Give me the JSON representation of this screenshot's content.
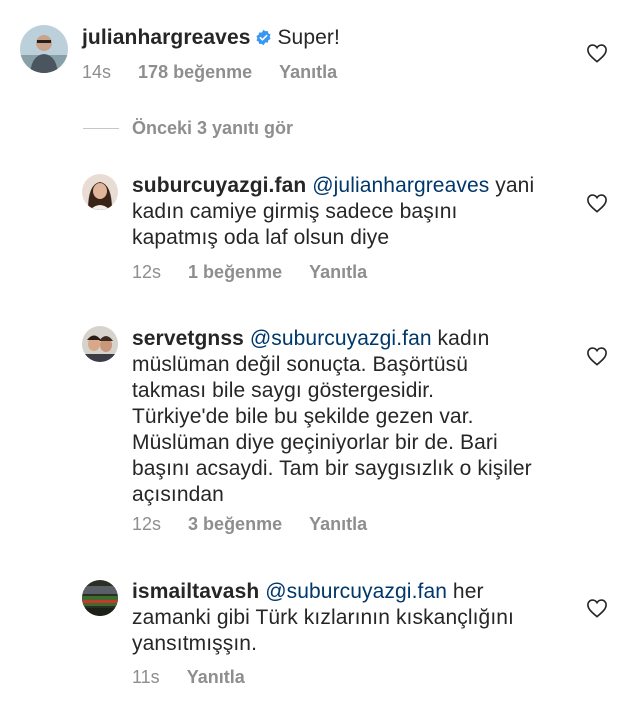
{
  "main_comment": {
    "username": "julianhargreaves",
    "text": "Super!",
    "time": "14s",
    "likes": "178 beğenme",
    "reply": "Yanıtla"
  },
  "view_replies": "Önceki 3 yanıtı gör",
  "replies": [
    {
      "username": "suburcuyazgi.fan",
      "mention": "@julianhargreaves",
      "text_lines": [
        " yani",
        "kadın  camiye girmiş sadece başını",
        "kapatmış oda laf olsun diye"
      ],
      "time": "12s",
      "likes": "1 beğenme",
      "reply": "Yanıtla"
    },
    {
      "username": "servetgnss",
      "mention": "@suburcuyazgi.fan",
      "text_lines": [
        " kadın",
        "müslüman değil sonuçta. Başörtüsü",
        "takması bile saygı göstergesidir.",
        "Türkiye'de bile bu şekilde gezen var.",
        "Müslüman diye geçiniyorlar bir de. Bari",
        "başını acsaydi. Tam bir saygısızlık o kişiler",
        "açısından"
      ],
      "time": "12s",
      "likes": "3 beğenme",
      "reply": "Yanıtla"
    },
    {
      "username": "ismailtavash",
      "mention": "@suburcuyazgi.fan",
      "text_lines": [
        " her",
        "zamanki gibi Türk kızlarının kıskançlığını",
        "yansıtmışşın."
      ],
      "time": "11s",
      "reply": "Yanıtla"
    }
  ],
  "colors": {
    "text": "#262626",
    "mention": "#00376b",
    "meta": "#8e8e8e",
    "verified": "#3897f0"
  }
}
